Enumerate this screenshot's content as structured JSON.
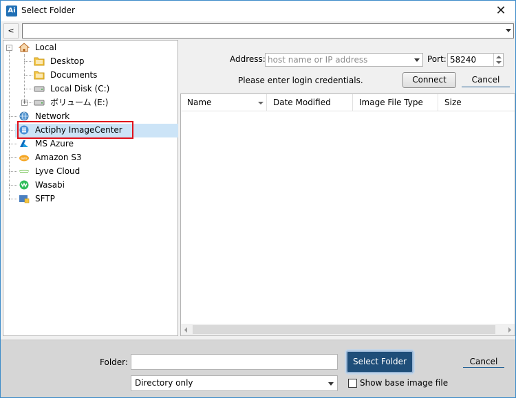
{
  "window": {
    "app_icon_text": "Ai",
    "title": "Select Folder",
    "close_glyph": "✕"
  },
  "pathbar": {
    "back_label": "<",
    "path_value": ""
  },
  "tree": {
    "items": [
      {
        "label": "Local",
        "icon": "home-icon"
      },
      {
        "label": "Desktop",
        "icon": "folder-icon"
      },
      {
        "label": "Documents",
        "icon": "folder-icon"
      },
      {
        "label": "Local Disk (C:)",
        "icon": "drive-icon"
      },
      {
        "label": "ボリューム (E:)",
        "icon": "drive-icon"
      },
      {
        "label": "Network",
        "icon": "network-globe-icon"
      },
      {
        "label": "Actiphy ImageCenter",
        "icon": "imagecenter-icon",
        "selected": true
      },
      {
        "label": "MS Azure",
        "icon": "azure-icon"
      },
      {
        "label": "Amazon S3",
        "icon": "aws-icon"
      },
      {
        "label": "Lyve Cloud",
        "icon": "lyve-cloud-icon"
      },
      {
        "label": "Wasabi",
        "icon": "wasabi-icon"
      },
      {
        "label": "SFTP",
        "icon": "sftp-icon"
      }
    ],
    "expander_glyph": "+",
    "expander_collapse_glyph": "-"
  },
  "connection": {
    "address_label": "Address:",
    "address_placeholder": "host name or IP address",
    "port_label": "Port:",
    "port_value": "58240",
    "credentials_msg": "Please enter login credentials.",
    "connect_label": "Connect",
    "cancel_label": "Cancel"
  },
  "list": {
    "columns": [
      "Name",
      "Date Modified",
      "Image File Type",
      "Size"
    ],
    "rows": []
  },
  "footer": {
    "folder_label": "Folder:",
    "folder_value": "",
    "filter_value": "Directory only",
    "select_label": "Select Folder",
    "show_base_label": "Show base image file",
    "show_base_checked": false,
    "cancel_label": "Cancel"
  },
  "colors": {
    "accent": "#1f4e79",
    "selection": "#cce4f7",
    "highlight_box": "#e0101a"
  }
}
